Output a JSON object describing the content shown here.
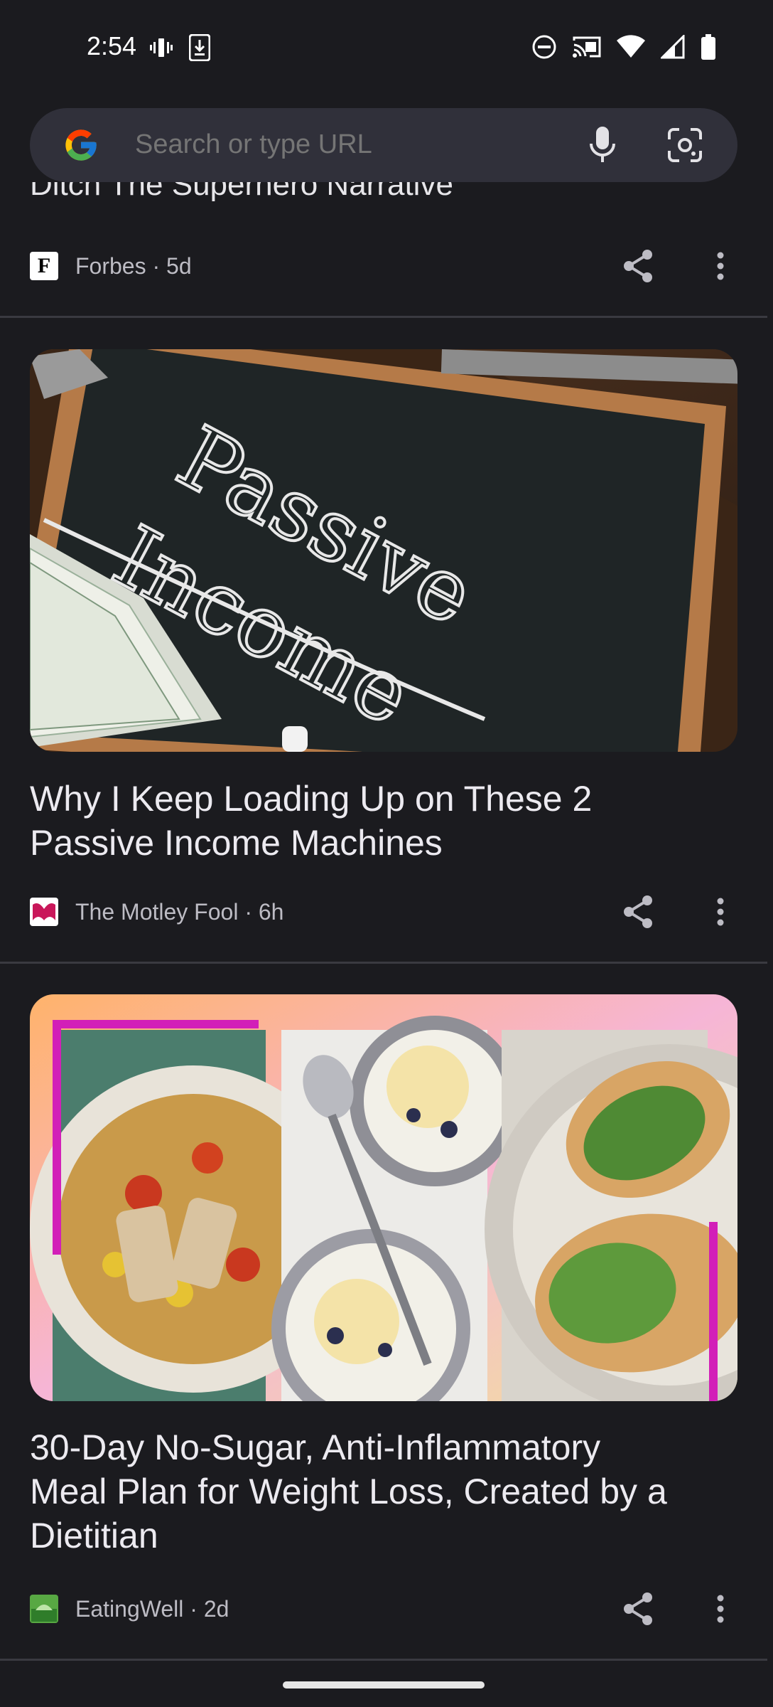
{
  "status_bar": {
    "time": "2:54"
  },
  "search": {
    "placeholder": "Search or type URL"
  },
  "feed": {
    "cards": [
      {
        "title": "Ditch The Superhero Narrative",
        "source": "Forbes",
        "age": "5d",
        "meta": "Forbes · 5d",
        "favicon_letter": "F"
      },
      {
        "title": "Why I Keep Loading Up on These 2 Passive Income Machines",
        "title_line1": "Why I Keep Loading Up on These 2",
        "title_line2": "Passive Income Machines",
        "source": "The Motley Fool",
        "age": "6h",
        "meta": "The Motley Fool · 6h",
        "image_text": [
          "Passive",
          "Income"
        ]
      },
      {
        "title": "30-Day No-Sugar, Anti-Inflammatory Meal Plan for Weight Loss, Created by a Dietitian",
        "title_line1": "30-Day No-Sugar, Anti-Inflammatory",
        "title_line2": "Meal Plan for Weight Loss, Created by a",
        "title_line3": "Dietitian",
        "source": "EatingWell",
        "age": "2d",
        "meta": "EatingWell · 2d"
      }
    ]
  },
  "colors": {
    "background": "#1b1b1f",
    "search_bar": "#30303a",
    "divider": "#3a3a40"
  },
  "icons": [
    "vibrate-icon",
    "download-icon",
    "dnd-icon",
    "cast-icon",
    "wifi-icon",
    "signal-icon",
    "battery-icon",
    "google-logo",
    "mic-icon",
    "lens-icon",
    "share-icon",
    "more-vert-icon"
  ]
}
